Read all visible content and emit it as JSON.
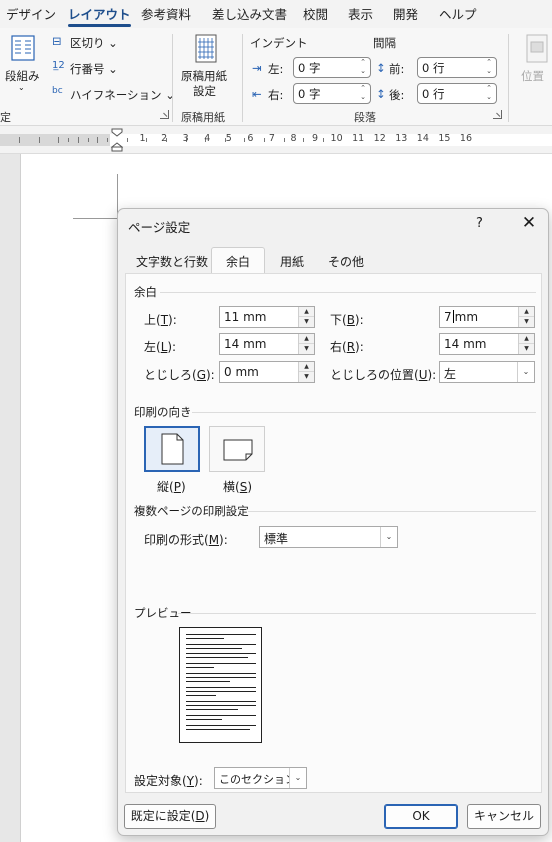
{
  "ribbon": {
    "tabs": [
      "デザイン",
      "レイアウト",
      "参考資料",
      "差し込み文書",
      "校閲",
      "表示",
      "開発",
      "ヘルプ"
    ],
    "active_tab": "レイアウト",
    "columns_label": "段組み",
    "breaks_label": "区切り",
    "line_numbers_label": "行番号",
    "hyphenation_label": "ハイフネーション",
    "genko_label_1": "原稿用紙",
    "genko_label_2": "設定",
    "group_genko": "原稿用紙",
    "indent_header": "インデント",
    "spacing_header": "間隔",
    "indent_left_label": "左:",
    "indent_left_value": "0 字",
    "indent_right_label": "右:",
    "indent_right_value": "0 字",
    "spacing_before_label": "前:",
    "spacing_before_value": "0 行",
    "spacing_after_label": "後:",
    "spacing_after_value": "0 行",
    "group_paragraph": "段落",
    "group_page_setup_partial": "定",
    "position_label": "位置"
  },
  "ruler": {
    "numbers": [
      "1",
      "2",
      "3",
      "4",
      "5",
      "6",
      "7",
      "8",
      "9",
      "10",
      "11",
      "12",
      "13",
      "14",
      "15",
      "16"
    ]
  },
  "dialog": {
    "title": "ページ設定",
    "help": "?",
    "close": "✕",
    "tabs": [
      "文字数と行数",
      "余白",
      "用紙",
      "その他"
    ],
    "active_tab": "余白",
    "margins_section": "余白",
    "top_label": "上(T):",
    "top_value": "11 mm",
    "bottom_label": "下(B):",
    "bottom_value": "7 mm",
    "left_label": "左(L):",
    "left_value": "14 mm",
    "right_label": "右(R):",
    "right_value": "14 mm",
    "gutter_label": "とじしろ(G):",
    "gutter_value": "0 mm",
    "gutter_pos_label": "とじしろの位置(U):",
    "gutter_pos_value": "左",
    "orientation_section": "印刷の向き",
    "portrait_label": "縦(P)",
    "landscape_label": "横(S)",
    "multipage_section": "複数ページの印刷設定",
    "print_format_label": "印刷の形式(M):",
    "print_format_value": "標準",
    "preview_section": "プレビュー",
    "apply_label": "設定対象(Y):",
    "apply_value": "このセクション",
    "default_button": "既定に設定(D)",
    "ok_button": "OK",
    "cancel_button": "キャンセル"
  }
}
